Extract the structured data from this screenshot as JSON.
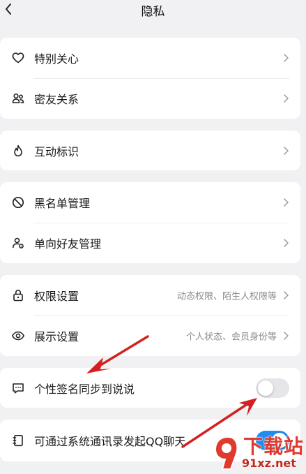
{
  "header": {
    "title": "隐私",
    "back_icon": "chevron-left-icon"
  },
  "groups": [
    {
      "items": [
        {
          "label": "特别关心",
          "icon": "heart-icon"
        },
        {
          "label": "密友关系",
          "icon": "friends-icon"
        }
      ]
    },
    {
      "items": [
        {
          "label": "互动标识",
          "icon": "flame-icon"
        }
      ]
    },
    {
      "items": [
        {
          "label": "黑名单管理",
          "icon": "block-icon"
        },
        {
          "label": "单向好友管理",
          "icon": "user-gear-icon"
        }
      ]
    },
    {
      "items": [
        {
          "label": "权限设置",
          "icon": "lock-icon",
          "hint": "动态权限、陌生人权限等"
        },
        {
          "label": "展示设置",
          "icon": "eye-icon",
          "hint": "个人状态、会员身份等"
        }
      ]
    },
    {
      "items": [
        {
          "label": "个性签名同步到说说",
          "icon": "message-icon",
          "toggle": false
        }
      ]
    },
    {
      "items": [
        {
          "label": "可通过系统通讯录发起QQ聊天",
          "icon": "contacts-book-icon",
          "toggle": true
        }
      ]
    }
  ],
  "colors": {
    "background": "#f1f1f4",
    "card": "#ffffff",
    "toggle_on": "#1f8df0",
    "annotation_arrow": "#d42020"
  },
  "watermark": {
    "big": "下载站",
    "small": "91xz.net"
  }
}
